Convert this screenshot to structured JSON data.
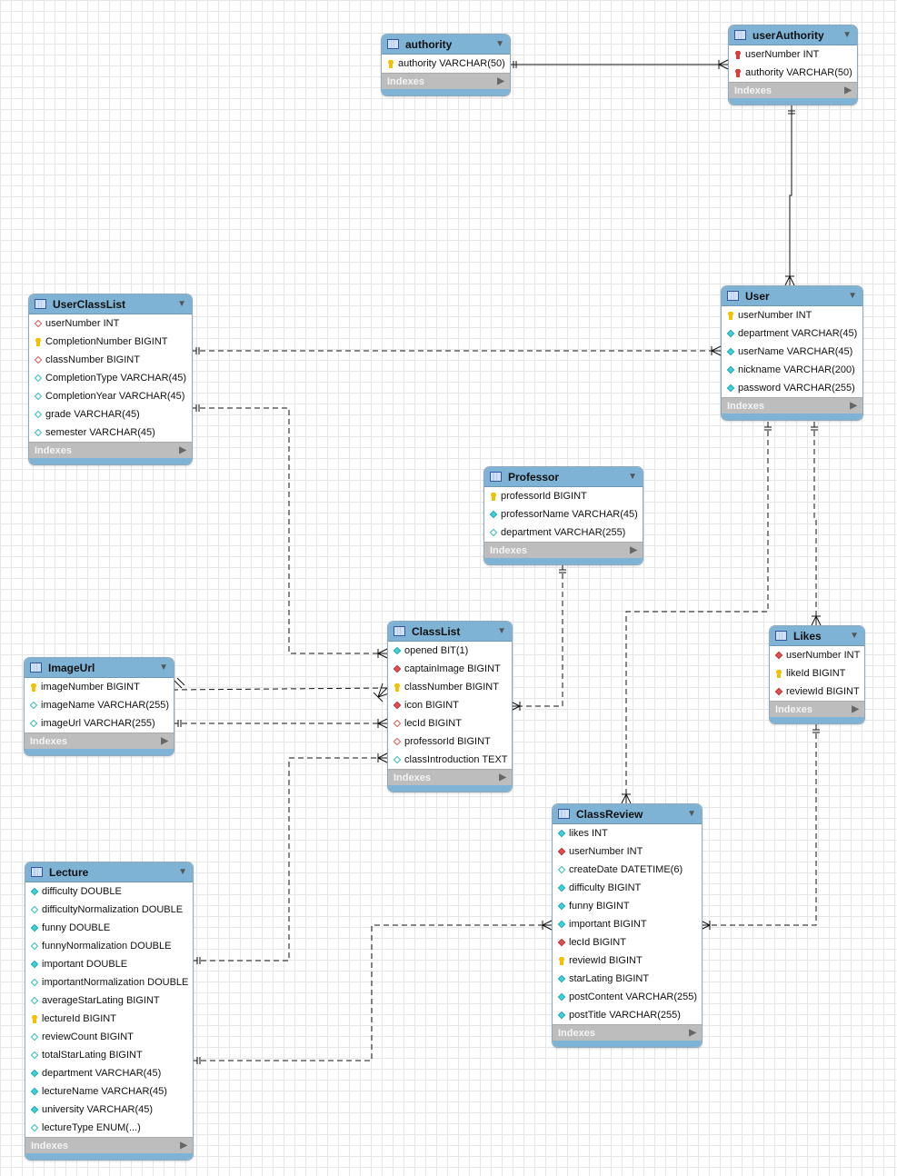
{
  "colors": {
    "header": "#7fb3d5",
    "indexes": "#bdbdbd",
    "key": "#f2c200",
    "fk": "#e05050",
    "column": "#3cd0e0"
  },
  "indexes_label": "Indexes",
  "tables": [
    {
      "id": "authority",
      "name": "authority",
      "columns": [
        {
          "name": "authority VARCHAR(50)",
          "icon": "key-yellow"
        }
      ]
    },
    {
      "id": "userAuthority",
      "name": "userAuthority",
      "columns": [
        {
          "name": "userNumber INT",
          "icon": "key-red"
        },
        {
          "name": "authority VARCHAR(50)",
          "icon": "key-red"
        }
      ]
    },
    {
      "id": "User",
      "name": "User",
      "columns": [
        {
          "name": "userNumber INT",
          "icon": "key-yellow"
        },
        {
          "name": "department VARCHAR(45)",
          "icon": "diamond-filled-cyan"
        },
        {
          "name": "userName VARCHAR(45)",
          "icon": "diamond-filled-cyan"
        },
        {
          "name": "nickname VARCHAR(200)",
          "icon": "diamond-filled-cyan"
        },
        {
          "name": "password VARCHAR(255)",
          "icon": "diamond-filled-cyan"
        }
      ]
    },
    {
      "id": "UserClassList",
      "name": "UserClassList",
      "columns": [
        {
          "name": "userNumber INT",
          "icon": "diamond-hollow-red"
        },
        {
          "name": "CompletionNumber BIGINT",
          "icon": "key-yellow"
        },
        {
          "name": "classNumber BIGINT",
          "icon": "diamond-hollow-red"
        },
        {
          "name": "CompletionType VARCHAR(45)",
          "icon": "diamond-hollow-cyan"
        },
        {
          "name": "CompletionYear VARCHAR(45)",
          "icon": "diamond-hollow-cyan"
        },
        {
          "name": "grade VARCHAR(45)",
          "icon": "diamond-hollow-cyan"
        },
        {
          "name": "semester VARCHAR(45)",
          "icon": "diamond-hollow-cyan"
        }
      ]
    },
    {
      "id": "Professor",
      "name": "Professor",
      "columns": [
        {
          "name": "professorId BIGINT",
          "icon": "key-yellow"
        },
        {
          "name": "professorName VARCHAR(45)",
          "icon": "diamond-filled-cyan"
        },
        {
          "name": "department VARCHAR(255)",
          "icon": "diamond-hollow-cyan"
        }
      ]
    },
    {
      "id": "ClassList",
      "name": "ClassList",
      "columns": [
        {
          "name": "opened BIT(1)",
          "icon": "diamond-filled-cyan"
        },
        {
          "name": "captainImage BIGINT",
          "icon": "diamond-filled-red"
        },
        {
          "name": "classNumber BIGINT",
          "icon": "key-yellow"
        },
        {
          "name": "icon BIGINT",
          "icon": "diamond-filled-red"
        },
        {
          "name": "lecId BIGINT",
          "icon": "diamond-hollow-red"
        },
        {
          "name": "professorId BIGINT",
          "icon": "diamond-hollow-red"
        },
        {
          "name": "classIntroduction TEXT",
          "icon": "diamond-hollow-cyan"
        }
      ]
    },
    {
      "id": "ImageUrl",
      "name": "ImageUrl",
      "columns": [
        {
          "name": "imageNumber BIGINT",
          "icon": "key-yellow"
        },
        {
          "name": "imageName VARCHAR(255)",
          "icon": "diamond-hollow-cyan"
        },
        {
          "name": "imageUrl VARCHAR(255)",
          "icon": "diamond-hollow-cyan"
        }
      ]
    },
    {
      "id": "Likes",
      "name": "Likes",
      "columns": [
        {
          "name": "userNumber INT",
          "icon": "diamond-filled-red"
        },
        {
          "name": "likeId BIGINT",
          "icon": "key-yellow"
        },
        {
          "name": "reviewId BIGINT",
          "icon": "diamond-filled-red"
        }
      ]
    },
    {
      "id": "ClassReview",
      "name": "ClassReview",
      "columns": [
        {
          "name": "likes INT",
          "icon": "diamond-filled-cyan"
        },
        {
          "name": "userNumber INT",
          "icon": "diamond-filled-red"
        },
        {
          "name": "createDate DATETIME(6)",
          "icon": "diamond-hollow-cyan"
        },
        {
          "name": "difficulty BIGINT",
          "icon": "diamond-filled-cyan"
        },
        {
          "name": "funny BIGINT",
          "icon": "diamond-filled-cyan"
        },
        {
          "name": "important BIGINT",
          "icon": "diamond-filled-cyan"
        },
        {
          "name": "lecId BIGINT",
          "icon": "diamond-filled-red"
        },
        {
          "name": "reviewId BIGINT",
          "icon": "key-yellow"
        },
        {
          "name": "starLating BIGINT",
          "icon": "diamond-filled-cyan"
        },
        {
          "name": "postContent VARCHAR(255)",
          "icon": "diamond-filled-cyan"
        },
        {
          "name": "postTitle VARCHAR(255)",
          "icon": "diamond-filled-cyan"
        }
      ]
    },
    {
      "id": "Lecture",
      "name": "Lecture",
      "columns": [
        {
          "name": "difficulty DOUBLE",
          "icon": "diamond-filled-cyan"
        },
        {
          "name": "difficultyNormalization DOUBLE",
          "icon": "diamond-hollow-cyan"
        },
        {
          "name": "funny DOUBLE",
          "icon": "diamond-filled-cyan"
        },
        {
          "name": "funnyNormalization DOUBLE",
          "icon": "diamond-hollow-cyan"
        },
        {
          "name": "important DOUBLE",
          "icon": "diamond-filled-cyan"
        },
        {
          "name": "importantNormalization DOUBLE",
          "icon": "diamond-hollow-cyan"
        },
        {
          "name": "averageStarLating BIGINT",
          "icon": "diamond-hollow-cyan"
        },
        {
          "name": "lectureId BIGINT",
          "icon": "key-yellow"
        },
        {
          "name": "reviewCount BIGINT",
          "icon": "diamond-hollow-cyan"
        },
        {
          "name": "totalStarLating BIGINT",
          "icon": "diamond-hollow-cyan"
        },
        {
          "name": "department VARCHAR(45)",
          "icon": "diamond-filled-cyan"
        },
        {
          "name": "lectureName VARCHAR(45)",
          "icon": "diamond-filled-cyan"
        },
        {
          "name": "university VARCHAR(45)",
          "icon": "diamond-filled-cyan"
        },
        {
          "name": "lectureType ENUM(...)",
          "icon": "diamond-hollow-cyan"
        }
      ]
    }
  ],
  "relationships": [
    {
      "from": "authority",
      "to": "userAuthority",
      "style": "identifying"
    },
    {
      "from": "User",
      "to": "userAuthority",
      "style": "identifying"
    },
    {
      "from": "User",
      "to": "UserClassList",
      "style": "non-identifying"
    },
    {
      "from": "ClassList",
      "to": "UserClassList",
      "style": "non-identifying"
    },
    {
      "from": "ImageUrl",
      "to": "ClassList",
      "style": "non-identifying"
    },
    {
      "from": "ImageUrl",
      "to": "ClassList",
      "style": "non-identifying"
    },
    {
      "from": "Professor",
      "to": "ClassList",
      "style": "non-identifying"
    },
    {
      "from": "Lecture",
      "to": "ClassList",
      "style": "non-identifying"
    },
    {
      "from": "Lecture",
      "to": "ClassReview",
      "style": "non-identifying"
    },
    {
      "from": "User",
      "to": "ClassReview",
      "style": "non-identifying"
    },
    {
      "from": "User",
      "to": "Likes",
      "style": "non-identifying"
    },
    {
      "from": "ClassReview",
      "to": "Likes",
      "style": "non-identifying"
    }
  ]
}
